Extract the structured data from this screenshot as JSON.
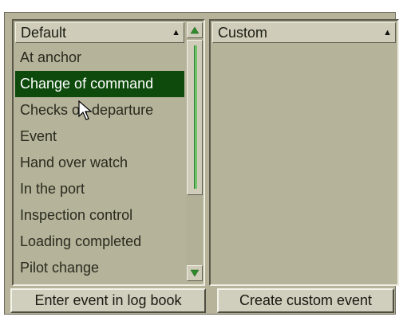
{
  "left_list": {
    "header": "Default",
    "sort_icon": "triangle-up",
    "items": [
      {
        "label": "At anchor"
      },
      {
        "label": "Change of command"
      },
      {
        "label": "Checks on departure"
      },
      {
        "label": "Event"
      },
      {
        "label": "Hand over watch"
      },
      {
        "label": "In the port"
      },
      {
        "label": "Inspection control"
      },
      {
        "label": "Loading completed"
      },
      {
        "label": "Pilot change"
      }
    ],
    "selected_index": 1
  },
  "right_list": {
    "header": "Custom",
    "sort_icon": "triangle-up"
  },
  "buttons": {
    "enter_event": "Enter event in log book",
    "create_custom": "Create custom event"
  },
  "colors": {
    "background": "#b6b39a",
    "selection": "#0d4a0b",
    "scroll_thumb_grip": "#6fc36b"
  }
}
